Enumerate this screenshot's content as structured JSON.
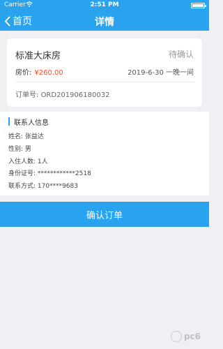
{
  "status_bar": {
    "carrier": "Carrier",
    "time": "2:51 PM"
  },
  "nav": {
    "back_label": "首页",
    "title": "详情"
  },
  "room": {
    "name": "标准大床房",
    "status": "待确认",
    "price_label": "房价:",
    "price": "¥260.00",
    "stay": "2019-6-30 一晚一间",
    "order_label": "订单号:",
    "order_no": "ORD201906180032"
  },
  "contact": {
    "title": "联系人信息",
    "name": "姓名: 张益达",
    "gender": "性别: 男",
    "guests": "入住人数: 1人",
    "id_card": "身份证号: ************2518",
    "phone": "联系方式: 170****9683"
  },
  "actions": {
    "confirm": "确认订单"
  },
  "watermark": {
    "text": "pc6"
  },
  "colors": {
    "primary": "#2aa3ee",
    "price": "#f24c2c",
    "background": "#efeff4"
  }
}
